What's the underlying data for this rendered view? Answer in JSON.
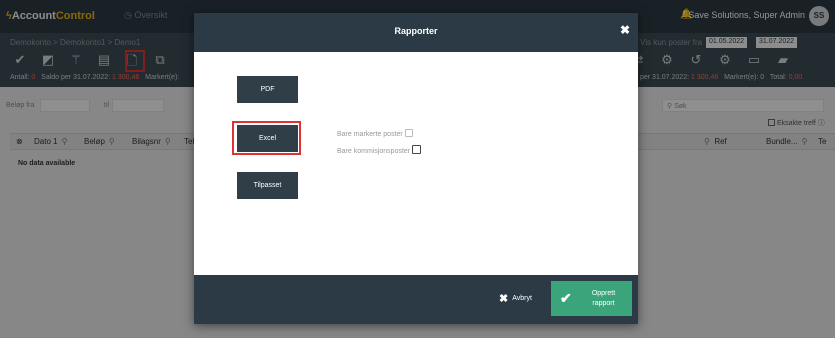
{
  "app": {
    "brand_prefix": "Account",
    "brand_suffix": "Control",
    "nav_item": "Oversikt",
    "user": "Save Solutions, Super Admin",
    "avatar_initials": "SS",
    "breadcrumb": "Demokonto > Demokonto1 > Demo1",
    "date_label": "Vis kun poster fra",
    "date_from": "01.05.2022",
    "date_to": "31.07.2022",
    "date_sep": "til"
  },
  "stats": {
    "antall_label": "Antall:",
    "antall_value": "0",
    "saldo_label": "Saldo per 31.07.2022:",
    "saldo_value": "1 300,46",
    "markert_label": "Markert(e):",
    "saldo2_label": "per 31.07.2022:",
    "saldo2_value": "1 300,46",
    "markert2_label": "Markert(e):",
    "markert2_value": "0",
    "total_label": "Total:",
    "total_value": "0,00"
  },
  "filters": {
    "belop_fra": "Beløp fra",
    "til": "til",
    "sok": "Søk",
    "eksakte": "Eksakte treff"
  },
  "grid": {
    "columns": [
      "Dato 1",
      "Beløp",
      "Bilagsnr",
      "Tek"
    ],
    "right_columns": [
      "Ref",
      "Bundle...",
      "Te"
    ],
    "no_data": "No data available"
  },
  "modal": {
    "title": "Rapporter",
    "close": "✖",
    "buttons": {
      "pdf": "PDF",
      "excel": "Excel",
      "tilpasset": "Tilpasset"
    },
    "options": {
      "bare_markerte": "Bare markerte poster",
      "bare_kommisjon": "Bare kommisjonsposter"
    },
    "footer": {
      "avbryt": "Avbryt",
      "opprett_line1": "Opprett",
      "opprett_line2": "rapport"
    }
  },
  "colors": {
    "header": "#2b3a44",
    "button": "#2f3e47",
    "accent_green": "#3aa57b",
    "highlight_red": "#d33",
    "brand_yellow": "#f0b400"
  },
  "icons": [
    "check-icon",
    "eraser-icon",
    "magic-wand-icon",
    "stack-icon",
    "document-icon",
    "copy-icon",
    "exchange-icon",
    "settings-icon",
    "undo-icon",
    "gears-icon",
    "ticket-icon",
    "folder-open-icon",
    "bell-icon",
    "search-icon"
  ]
}
